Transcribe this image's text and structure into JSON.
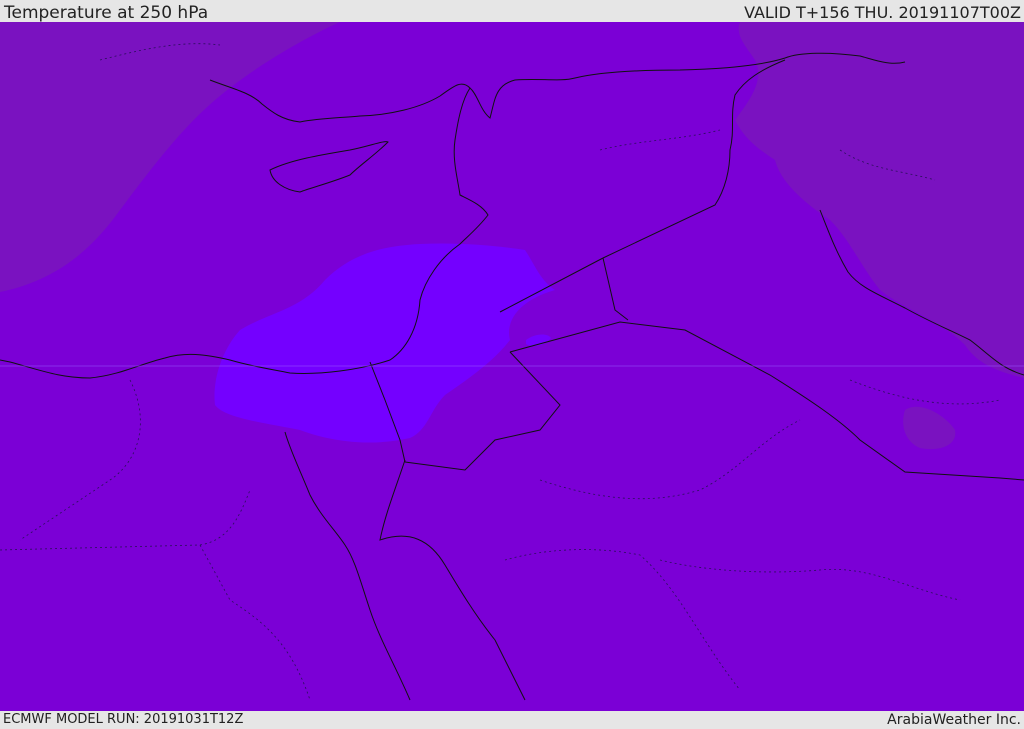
{
  "header": {
    "title": "Temperature at 250 hPa",
    "valid": "VALID T+156 THU. 20191107T00Z"
  },
  "footer": {
    "model_run": "ECMWF MODEL RUN: 20191031T12Z",
    "credit": "ArabiaWeather Inc."
  },
  "colors": {
    "base_fill": "#7b00d6",
    "cold_fill": "#7a12c0",
    "warm_fill": "#7400ff",
    "border_line": "#111111"
  }
}
